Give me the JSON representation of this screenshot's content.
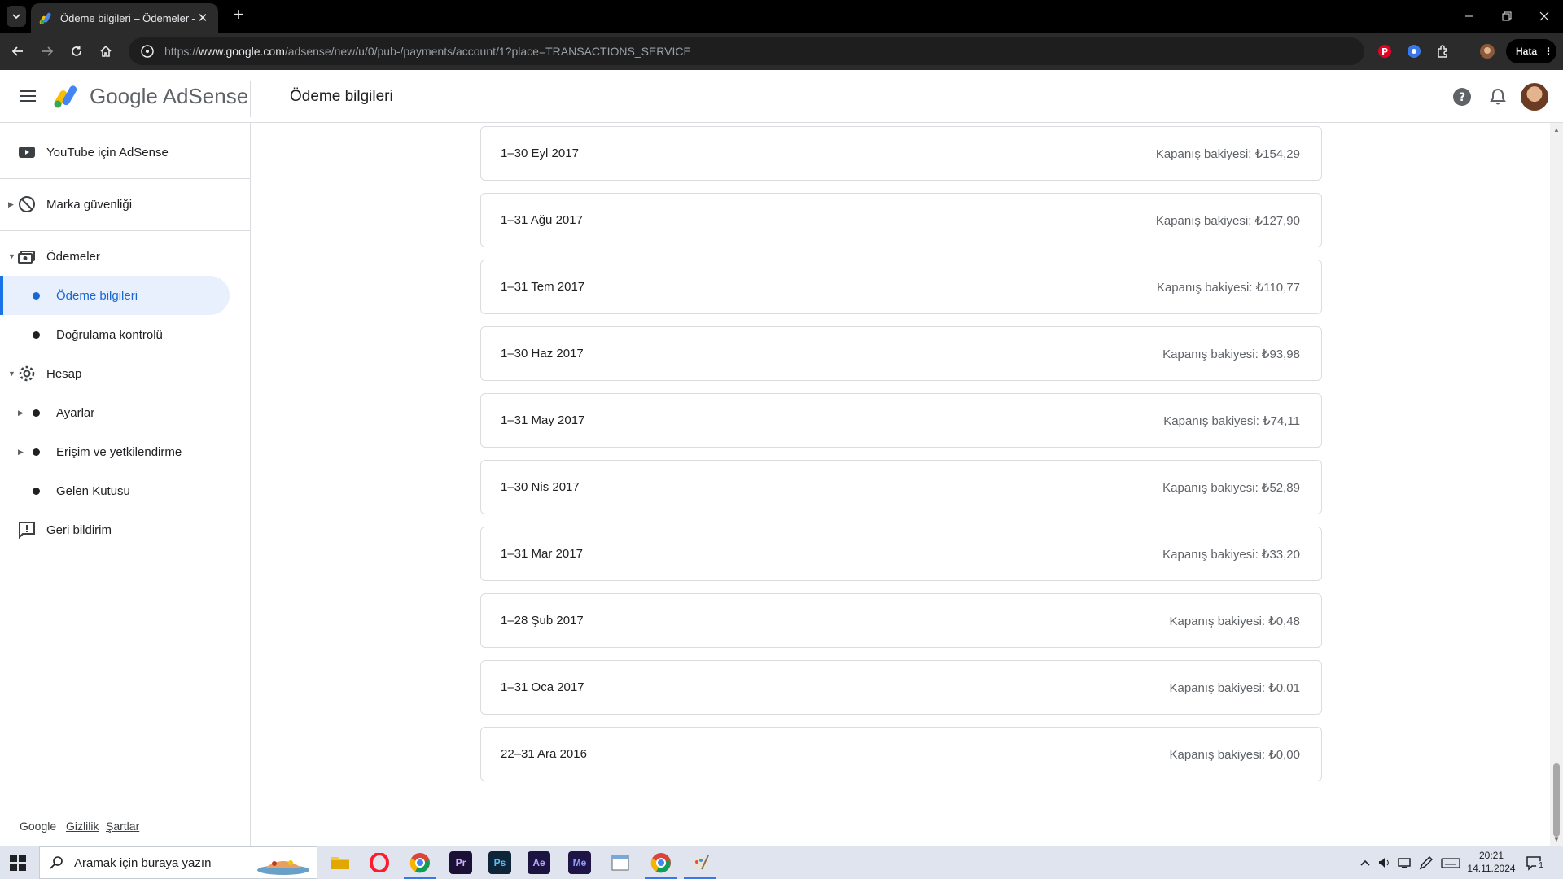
{
  "browser": {
    "tab_title": "Ödeme bilgileri – Ödemeler – G",
    "url_prefix": "https://",
    "url_host": "www.google.com",
    "url_path": "/adsense/new/u/0/pub-/payments/account/1?place=TRANSACTIONS_SERVICE",
    "profile_status": "Hata"
  },
  "header": {
    "brand": "Google AdSense",
    "page_title": "Ödeme bilgileri"
  },
  "sidebar": {
    "items": [
      {
        "label": "YouTube için AdSense"
      },
      {
        "label": "Marka güvenliği"
      },
      {
        "label": "Ödemeler"
      },
      {
        "label": "Ödeme bilgileri"
      },
      {
        "label": "Doğrulama kontrolü"
      },
      {
        "label": "Hesap"
      },
      {
        "label": "Ayarlar"
      },
      {
        "label": "Erişim ve yetkilendirme"
      },
      {
        "label": "Gelen Kutusu"
      },
      {
        "label": "Geri bildirim"
      }
    ],
    "footer": {
      "google": "Google",
      "privacy": "Gizlilik",
      "terms": "Şartlar"
    }
  },
  "statements": [
    {
      "period": "1–30 Eyl 2017",
      "balance": "Kapanış bakiyesi: ₺154,29"
    },
    {
      "period": "1–31 Ağu 2017",
      "balance": "Kapanış bakiyesi: ₺127,90"
    },
    {
      "period": "1–31 Tem 2017",
      "balance": "Kapanış bakiyesi: ₺110,77"
    },
    {
      "period": "1–30 Haz 2017",
      "balance": "Kapanış bakiyesi: ₺93,98"
    },
    {
      "period": "1–31 May 2017",
      "balance": "Kapanış bakiyesi: ₺74,11"
    },
    {
      "period": "1–30 Nis 2017",
      "balance": "Kapanış bakiyesi: ₺52,89"
    },
    {
      "period": "1–31 Mar 2017",
      "balance": "Kapanış bakiyesi: ₺33,20"
    },
    {
      "period": "1–28 Şub 2017",
      "balance": "Kapanış bakiyesi: ₺0,48"
    },
    {
      "period": "1–31 Oca 2017",
      "balance": "Kapanış bakiyesi: ₺0,01"
    },
    {
      "period": "22–31 Ara 2016",
      "balance": "Kapanış bakiyesi: ₺0,00"
    }
  ],
  "taskbar": {
    "search_placeholder": "Aramak için buraya yazın",
    "apps": [
      "Pr",
      "Ps",
      "Ae",
      "Me"
    ],
    "time": "20:21",
    "date": "14.11.2024",
    "notification_count": "1"
  },
  "colors": {
    "accent": "#1a73e8",
    "active_bg": "#e8f0fe",
    "border": "#dadce0"
  }
}
